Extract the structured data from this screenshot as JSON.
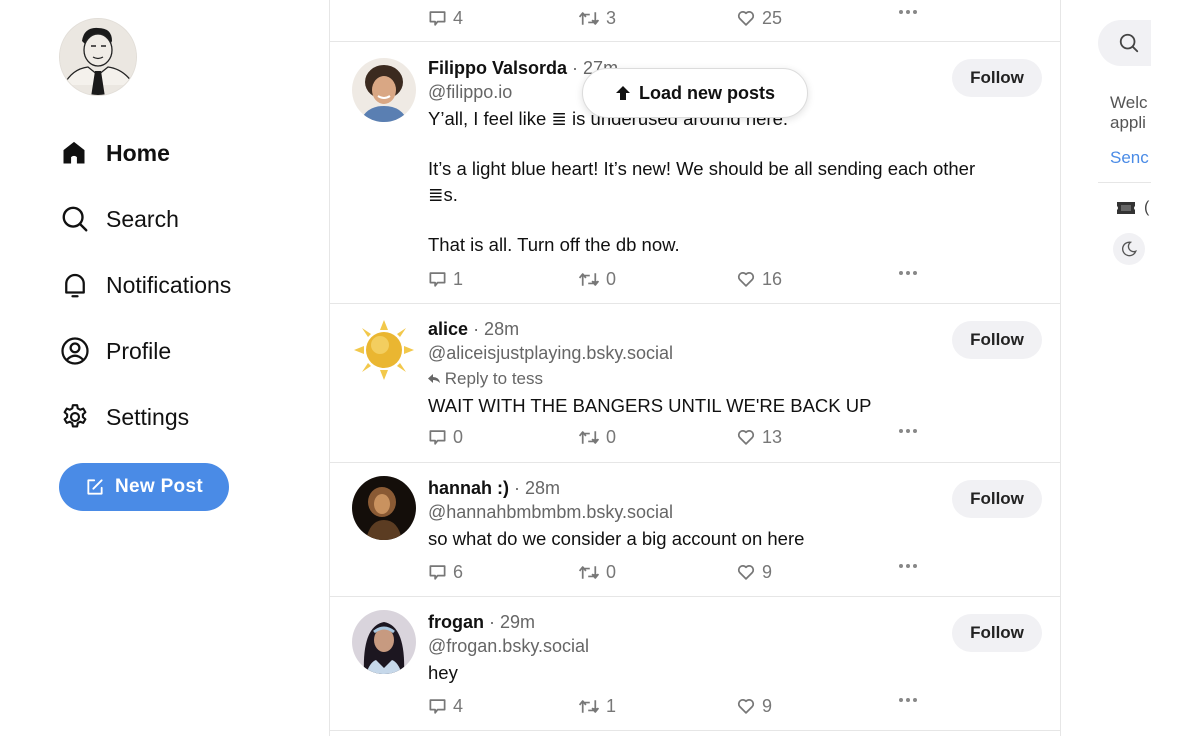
{
  "sidebar": {
    "user_avatar": "user-avatar-cartoon",
    "nav": [
      {
        "label": "Home",
        "icon": "home-icon",
        "active": true
      },
      {
        "label": "Search",
        "icon": "search-icon",
        "active": false
      },
      {
        "label": "Notifications",
        "icon": "bell-icon",
        "active": false
      },
      {
        "label": "Profile",
        "icon": "user-circle-icon",
        "active": false
      },
      {
        "label": "Settings",
        "icon": "gear-icon",
        "active": false
      }
    ],
    "new_post_label": "New Post"
  },
  "feed": {
    "load_new_posts_label": "Load new posts",
    "top_partial_post": {
      "replies": "4",
      "reposts": "3",
      "likes": "25"
    },
    "posts": [
      {
        "name": "Filippo Valsorda",
        "time": "· 27m",
        "handle": "@filippo.io",
        "reply_to": "",
        "text_lines": [
          "Y’all, I feel like ≣ is underused around here.",
          "",
          "It’s a light blue heart! It’s new! We should be all sending each other",
          "≣s.",
          "",
          "That is all. Turn off the db now."
        ],
        "replies": "1",
        "reposts": "0",
        "likes": "16",
        "follow_label": "Follow"
      },
      {
        "name": "alice",
        "time": "· 28m",
        "handle": "@aliceisjustplaying.bsky.social",
        "reply_to": "Reply to tess",
        "text_lines": [
          "WAIT WITH THE BANGERS UNTIL WE'RE BACK UP"
        ],
        "replies": "0",
        "reposts": "0",
        "likes": "13",
        "follow_label": "Follow"
      },
      {
        "name": "hannah :)",
        "time": "· 28m",
        "handle": "@hannahbmbmbm.bsky.social",
        "reply_to": "",
        "text_lines": [
          "so what do we consider a big account on here"
        ],
        "replies": "6",
        "reposts": "0",
        "likes": "9",
        "follow_label": "Follow"
      },
      {
        "name": "frogan",
        "time": "· 29m",
        "handle": "@frogan.bsky.social",
        "reply_to": "",
        "text_lines": [
          "hey"
        ],
        "replies": "4",
        "reposts": "1",
        "likes": "9",
        "follow_label": "Follow"
      }
    ]
  },
  "right_panel": {
    "search_placeholder": "Search",
    "welcome_line1": "Welc",
    "welcome_line2": "appli",
    "send_link": "Senc",
    "feedback_label": "(",
    "theme_icon": "moon-icon"
  },
  "colors": {
    "accent": "#4a8be6",
    "follow_bg": "#f1f1f4",
    "muted_text": "#666666",
    "border": "#e6e6e6"
  }
}
